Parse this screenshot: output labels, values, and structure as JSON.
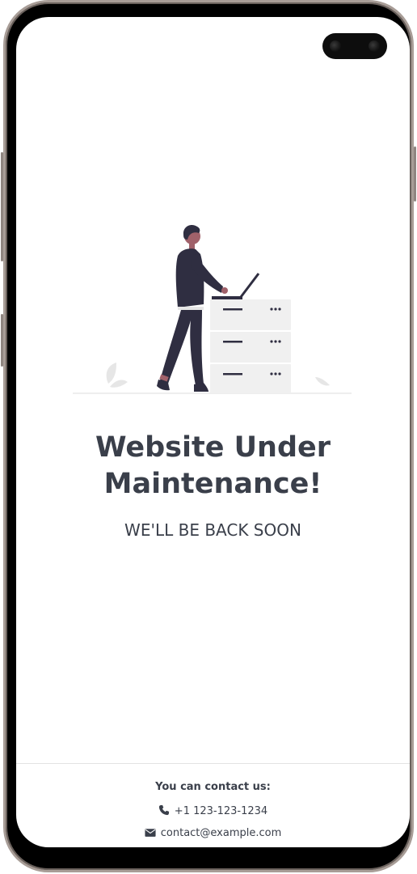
{
  "maintenance": {
    "title_line1": "Website Under",
    "title_line2": "Maintenance!",
    "subtitle": "WE'LL BE BACK SOON"
  },
  "contact": {
    "heading": "You can contact us:",
    "phone": "+1 123-123-1234",
    "email": "contact@example.com",
    "phone_icon": "phone-icon",
    "email_icon": "envelope-icon"
  },
  "colors": {
    "text": "#3a3f4a",
    "illustration_dark": "#2f2e41",
    "cabinet": "#f0f0f0"
  }
}
